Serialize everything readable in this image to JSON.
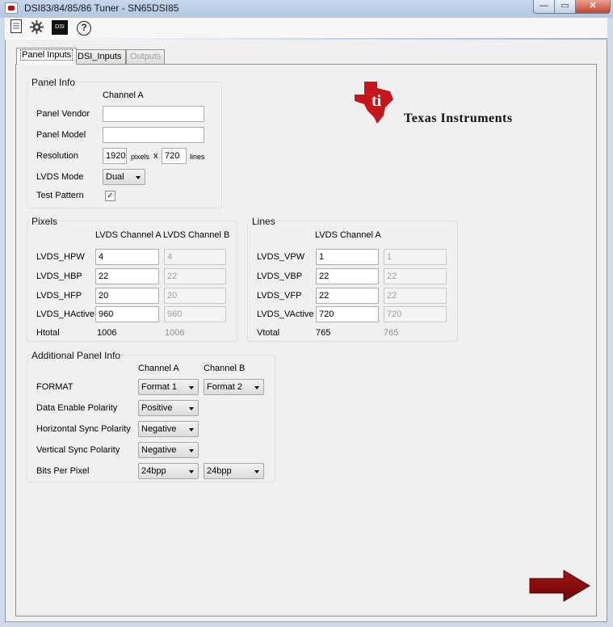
{
  "window": {
    "title": "DSI83/84/85/86 Tuner - SN65DSI85",
    "min_label": "—",
    "max_label": "▭",
    "close_label": "✕"
  },
  "toolbar": {
    "dsi_label": "DSI",
    "help_label": "?"
  },
  "tabs": [
    {
      "label": "Panel Inputs",
      "selected": true
    },
    {
      "label": "DSI_Inputs",
      "selected": false
    },
    {
      "label": "Outputs",
      "enabled": false
    }
  ],
  "panel_info": {
    "title": "Panel Info",
    "channel_header": "Channel A",
    "vendor_label": "Panel Vendor",
    "vendor_value": "",
    "model_label": "Panel Model",
    "model_value": "",
    "resolution_label": "Resolution",
    "res_width": "1920",
    "res_pixels_unit": "pixels",
    "res_x": "x",
    "res_height": "720",
    "res_lines_unit": "lines",
    "lvds_mode_label": "LVDS Mode",
    "lvds_mode_value": "Dual",
    "test_pattern_label": "Test Pattern",
    "test_pattern_checked": true,
    "check_glyph": "✓"
  },
  "pixels": {
    "title": "Pixels",
    "col_a": "LVDS Channel A",
    "col_b": "LVDS Channel B",
    "rows": [
      {
        "label": "LVDS_HPW",
        "a": "4",
        "b": "4"
      },
      {
        "label": "LVDS_HBP",
        "a": "22",
        "b": "22"
      },
      {
        "label": "LVDS_HFP",
        "a": "20",
        "b": "20"
      },
      {
        "label": "LVDS_HActive",
        "a": "960",
        "b": "960"
      }
    ],
    "total_label": "Htotal",
    "total_a": "1006",
    "total_b": "1006"
  },
  "lines": {
    "title": "Lines",
    "col_a": "LVDS Channel A",
    "rows": [
      {
        "label": "LVDS_VPW",
        "a": "1",
        "b": "1"
      },
      {
        "label": "LVDS_VBP",
        "a": "22",
        "b": "22"
      },
      {
        "label": "LVDS_VFP",
        "a": "22",
        "b": "22"
      },
      {
        "label": "LVDS_VActive",
        "a": "720",
        "b": "720"
      }
    ],
    "total_label": "Vtotal",
    "total_a": "765",
    "total_b": "765"
  },
  "additional": {
    "title": "Additional Panel Info",
    "col_a": "Channel A",
    "col_b": "Channel B",
    "format_label": "FORMAT",
    "format_a": "Format 1",
    "format_b": "Format 2",
    "de_label": "Data Enable Polarity",
    "de_value": "Positive",
    "hsync_label": "Horizontal Sync Polarity",
    "hsync_value": "Negative",
    "vsync_label": "Vertical Sync Polarity",
    "vsync_value": "Negative",
    "bpp_label": "Bits Per Pixel",
    "bpp_a": "24bpp",
    "bpp_b": "24bpp"
  },
  "logo": {
    "company": "Texas Instruments",
    "brand_color": "#c4161c"
  },
  "colors": {
    "arrow": "#8b0a0a"
  }
}
